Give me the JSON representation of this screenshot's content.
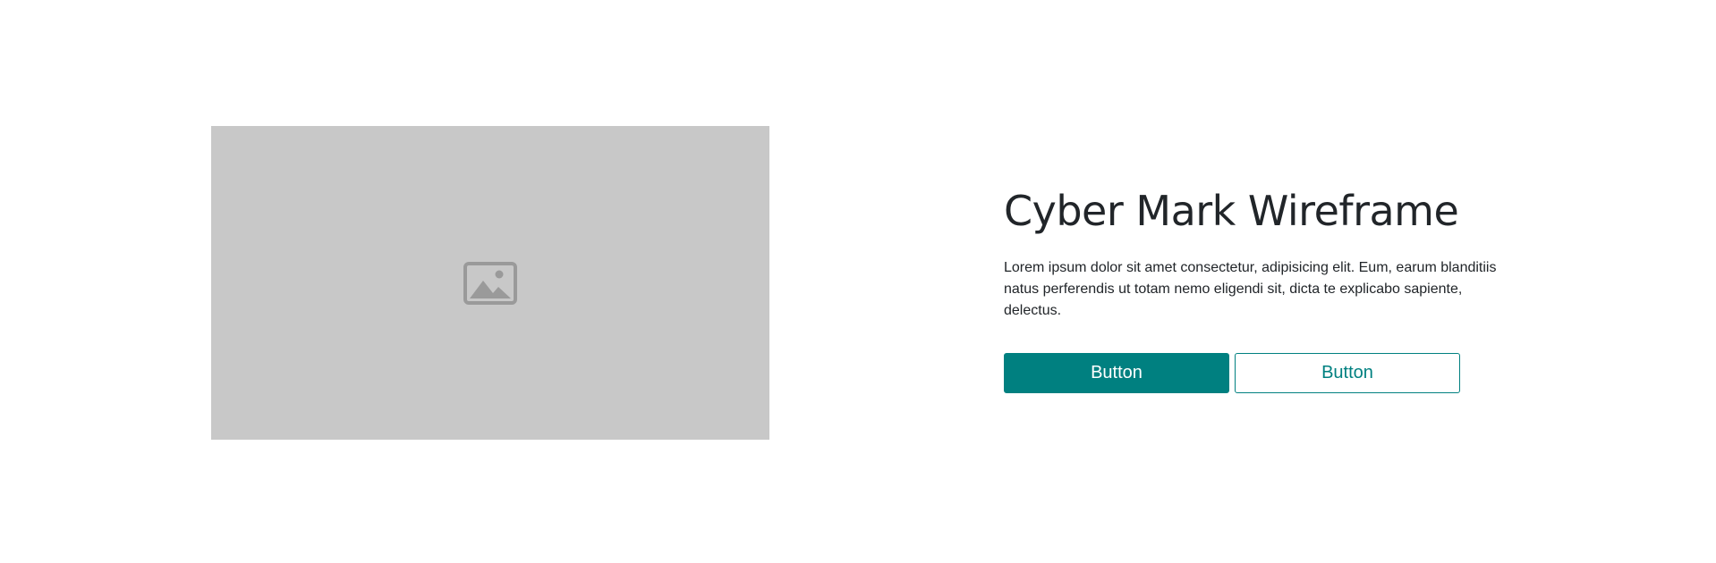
{
  "hero": {
    "image": {
      "icon": "image-icon",
      "background_color": "#c8c8c8",
      "icon_color": "#9a9a9a"
    },
    "title": "Cyber Mark Wireframe",
    "description": "Lorem ipsum dolor sit amet consectetur, adipisicing elit. Eum, earum blanditiis natus perferendis ut totam nemo eligendi sit, dicta te explicabo sapiente, delectus.",
    "buttons": {
      "primary_label": "Button",
      "secondary_label": "Button"
    },
    "accent_color": "#008080"
  }
}
